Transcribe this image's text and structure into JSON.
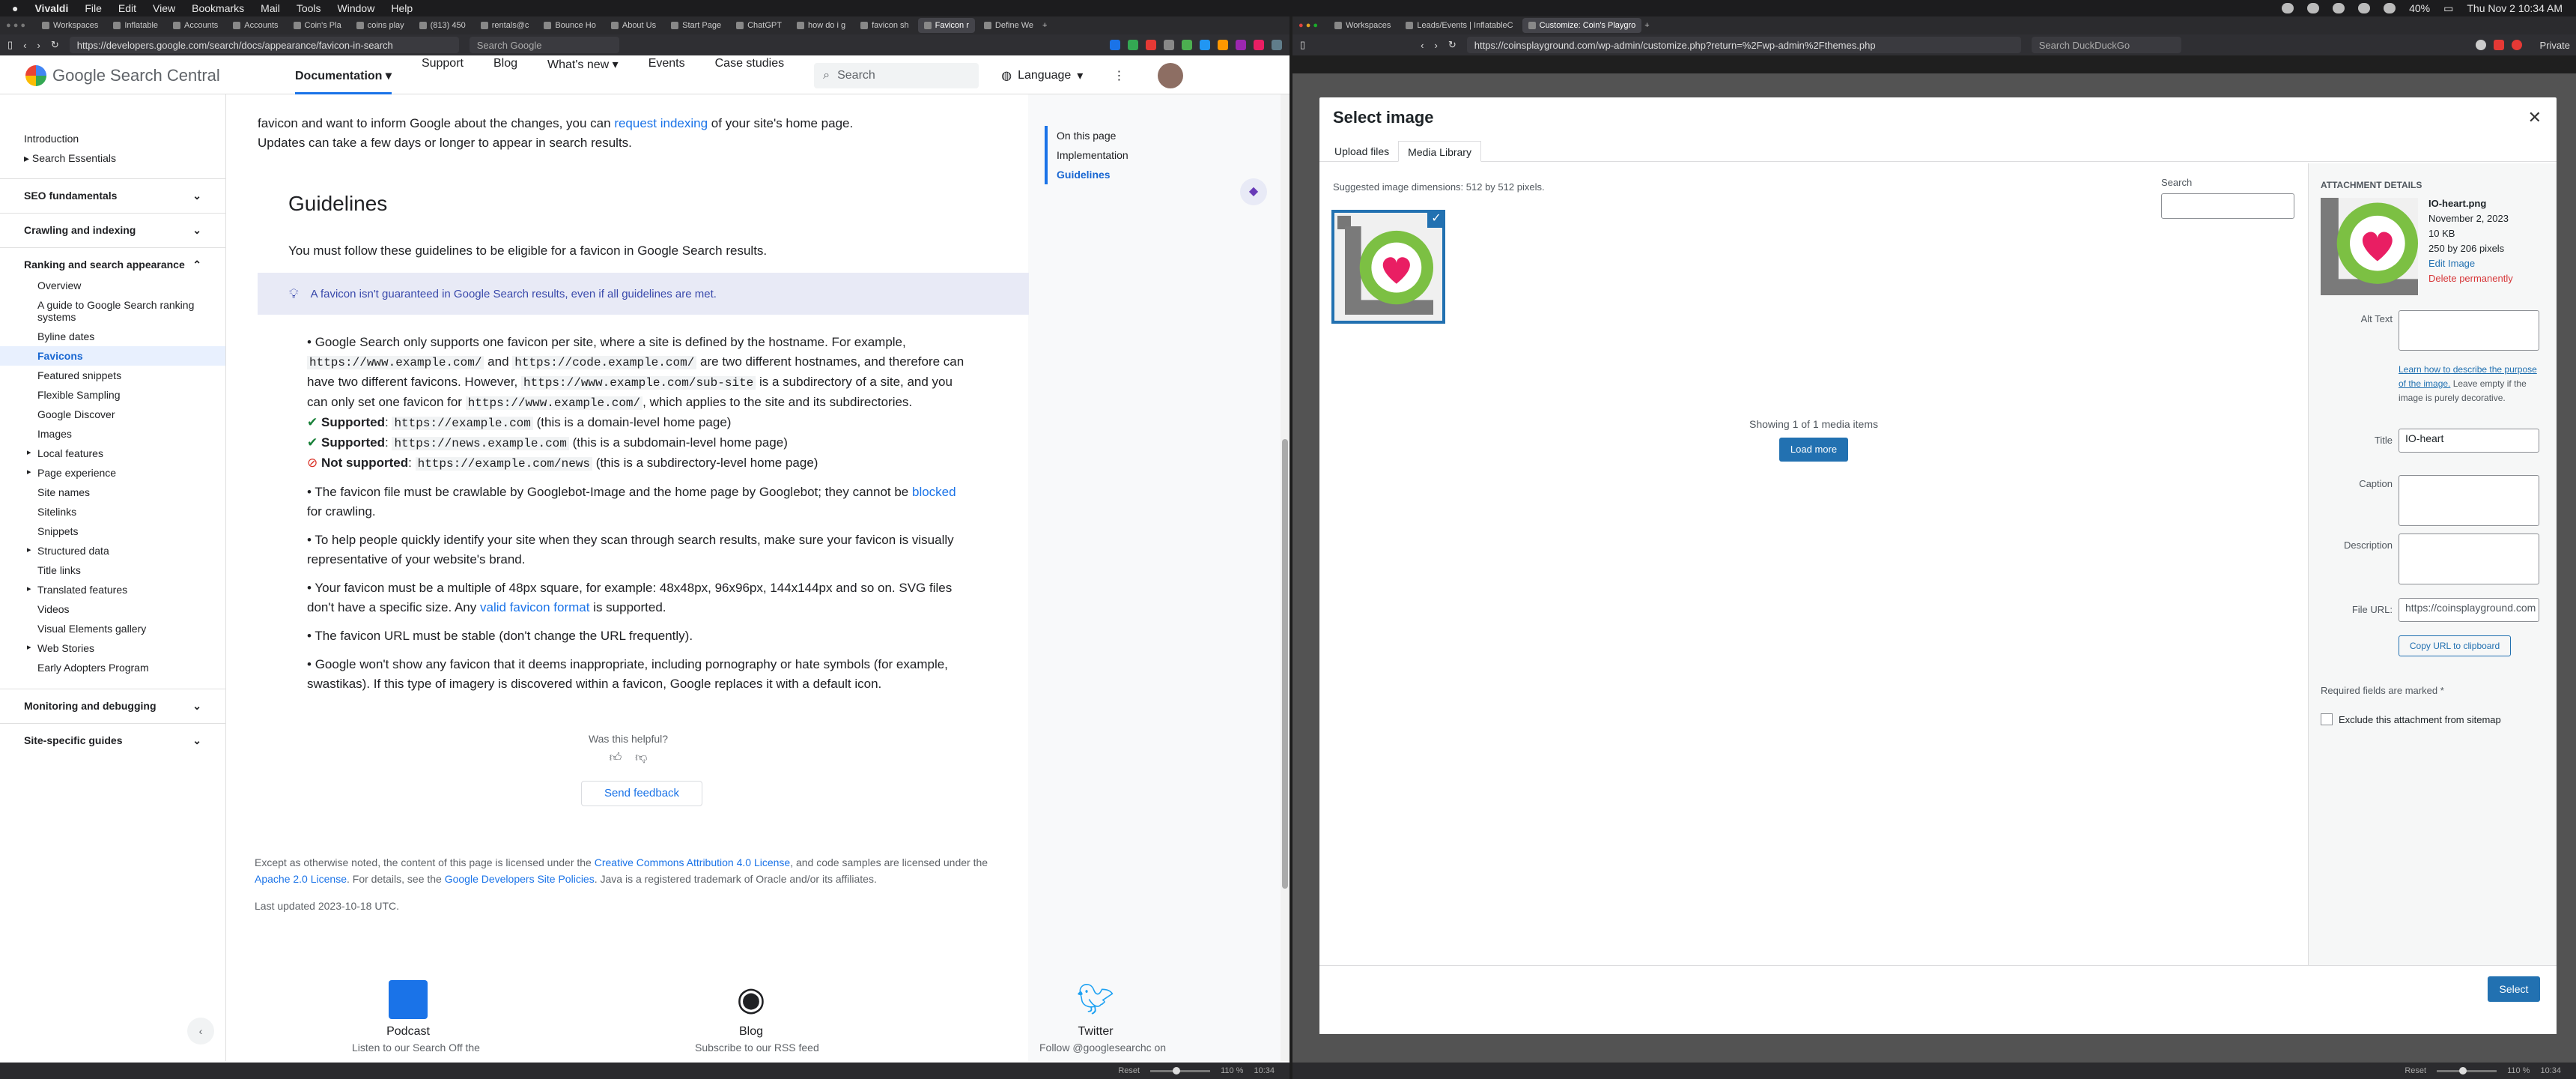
{
  "menubar": {
    "app": "Vivaldi",
    "items": [
      "File",
      "Edit",
      "View",
      "Bookmarks",
      "Mail",
      "Tools",
      "Window",
      "Help"
    ],
    "battery": "40%",
    "clock": "Thu Nov 2  10:34 AM"
  },
  "left_window": {
    "tabs": [
      "Workspaces",
      "Inflatable",
      "Accounts",
      "Accounts",
      "Coin's Pla",
      "coins play",
      "(813) 450",
      "rentals@c",
      "Bounce Ho",
      "About Us",
      "Start Page",
      "ChatGPT",
      "how do i g",
      "favicon sh",
      "Favicon r",
      "Define We"
    ],
    "url": "https://developers.google.com/search/docs/appearance/favicon-in-search",
    "search_placeholder": "Search Google",
    "site": {
      "logo_text": "Google Search Central",
      "nav": [
        "Documentation",
        "Support",
        "Blog",
        "What's new",
        "Events",
        "Case studies"
      ],
      "search_placeholder": "Search",
      "language": "Language"
    },
    "sidebar": {
      "top_items": [
        "Introduction",
        "Search Essentials"
      ],
      "sections": [
        "SEO fundamentals",
        "Crawling and indexing",
        "Ranking and search appearance"
      ],
      "sub_items": [
        "Overview",
        "A guide to Google Search ranking systems",
        "Byline dates",
        "Favicons",
        "Featured snippets",
        "Flexible Sampling",
        "Google Discover",
        "Images",
        "Local features",
        "Page experience",
        "Site names",
        "Sitelinks",
        "Snippets",
        "Structured data",
        "Title links",
        "Translated features",
        "Videos",
        "Visual Elements gallery",
        "Web Stories",
        "Early Adopters Program"
      ],
      "bottom_sections": [
        "Monitoring and debugging",
        "Site-specific guides"
      ]
    },
    "toc": {
      "heading": "On this page",
      "items": [
        "Implementation",
        "Guidelines"
      ]
    },
    "article": {
      "intro_1": "favicon and want to inform Google about the changes, you can ",
      "intro_link": "request indexing",
      "intro_2": " of your site's home page.",
      "intro_3": "Updates can take a few days or longer to appear in search results.",
      "heading": "Guidelines",
      "lead": "You must follow these guidelines to be eligible for a favicon in Google Search results.",
      "note": "A favicon isn't guaranteed in Google Search results, even if all guidelines are met.",
      "b1_1": "Google Search only supports one favicon per site, where a site is defined by the hostname. For example,",
      "b1_c1": "https://www.example.com/",
      "b1_and": " and ",
      "b1_c2": "https://code.example.com/",
      "b1_2": " are two different hostnames, and therefore can",
      "b1_3": "have two different favicons. However, ",
      "b1_c3": "https://www.example.com/sub-site",
      "b1_4": " is a subdirectory of a site, and you",
      "b1_5": "can only set one favicon for ",
      "b1_c4": "https://www.example.com/",
      "b1_6": ", which applies to the site and its subdirectories.",
      "s1_label": "Supported",
      "s1_code": "https://example.com",
      "s1_text": "(this is a domain-level home page)",
      "s2_label": "Supported",
      "s2_code": "https://news.example.com",
      "s2_text": "(this is a subdomain-level home page)",
      "s3_label": "Not supported",
      "s3_code": "https://example.com/news",
      "s3_text": "(this is a subdirectory-level home page)",
      "b2_1": "The favicon file must be crawlable by Googlebot-Image and the home page by Googlebot; they cannot be ",
      "b2_link": "blocked",
      "b2_2": "for crawling.",
      "b3_1": "To help people quickly identify your site when they scan through search results, make sure your favicon is visually",
      "b3_2": "representative of your website's brand.",
      "b4_1": "Your favicon must be a multiple of 48px square, for example: 48x48px, 96x96px, 144x144px and so on. SVG files",
      "b4_2": "don't have a specific size. Any ",
      "b4_link": "valid favicon format",
      "b4_3": " is supported.",
      "b5": "The favicon URL must be stable (don't change the URL frequently).",
      "b6_1": "Google won't show any favicon that it deems inappropriate, including pornography or hate symbols (for example,",
      "b6_2": "swastikas). If this type of imagery is discovered within a favicon, Google replaces it with a default icon.",
      "helpful": "Was this helpful?",
      "send_feedback": "Send feedback",
      "license_1": "Except as otherwise noted, the content of this page is licensed under the ",
      "license_link1": "Creative Commons Attribution 4.0 License",
      "license_2": ", and code samples are licensed under the",
      "license_link2": "Apache 2.0 License",
      "license_3": ". For details, see the ",
      "license_link3": "Google Developers Site Policies",
      "license_4": ". Java is a registered trademark of Oracle and/or its affiliates.",
      "updated": "Last updated 2023-10-18 UTC."
    },
    "footer_links": [
      {
        "title": "Podcast",
        "sub": "Listen to our Search Off the"
      },
      {
        "title": "Blog",
        "sub": "Subscribe to our RSS feed"
      },
      {
        "title": "Twitter",
        "sub": "Follow @googlesearchc on"
      }
    ],
    "status_zoom": "110 %",
    "status_time": "10:34",
    "status_reset": "Reset"
  },
  "right_window": {
    "tabs": [
      "Workspaces",
      "Leads/Events | InflatableC",
      "Customize: Coin's Playgro"
    ],
    "url": "https://coinsplayground.com/wp-admin/customize.php?return=%2Fwp-admin%2Fthemes.php",
    "search_placeholder": "Search DuckDuckGo",
    "private_label": "Private",
    "status_zoom": "110 %",
    "status_time": "10:34",
    "status_reset": "Reset",
    "modal": {
      "title": "Select image",
      "tabs": [
        "Upload files",
        "Media Library"
      ],
      "suggested": "Suggested image dimensions: 512 by 512 pixels.",
      "search_label": "Search",
      "showing": "Showing 1 of 1 media items",
      "load_more": "Load more",
      "select": "Select",
      "details": {
        "heading": "Attachment details",
        "filename": "IO-heart.png",
        "date": "November 2, 2023",
        "size": "10 KB",
        "dims": "250 by 206 pixels",
        "edit": "Edit Image",
        "delete": "Delete permanently",
        "alt_label": "Alt Text",
        "alt_help_link": "Learn how to describe the purpose of the image.",
        "alt_help": " Leave empty if the image is purely decorative.",
        "title_label": "Title",
        "title_value": "IO-heart",
        "caption_label": "Caption",
        "description_label": "Description",
        "fileurl_label": "File URL:",
        "fileurl_value": "https://coinsplayground.com",
        "copy_btn": "Copy URL to clipboard",
        "required": "Required fields are marked *",
        "exclude": "Exclude this attachment from sitemap"
      }
    }
  }
}
